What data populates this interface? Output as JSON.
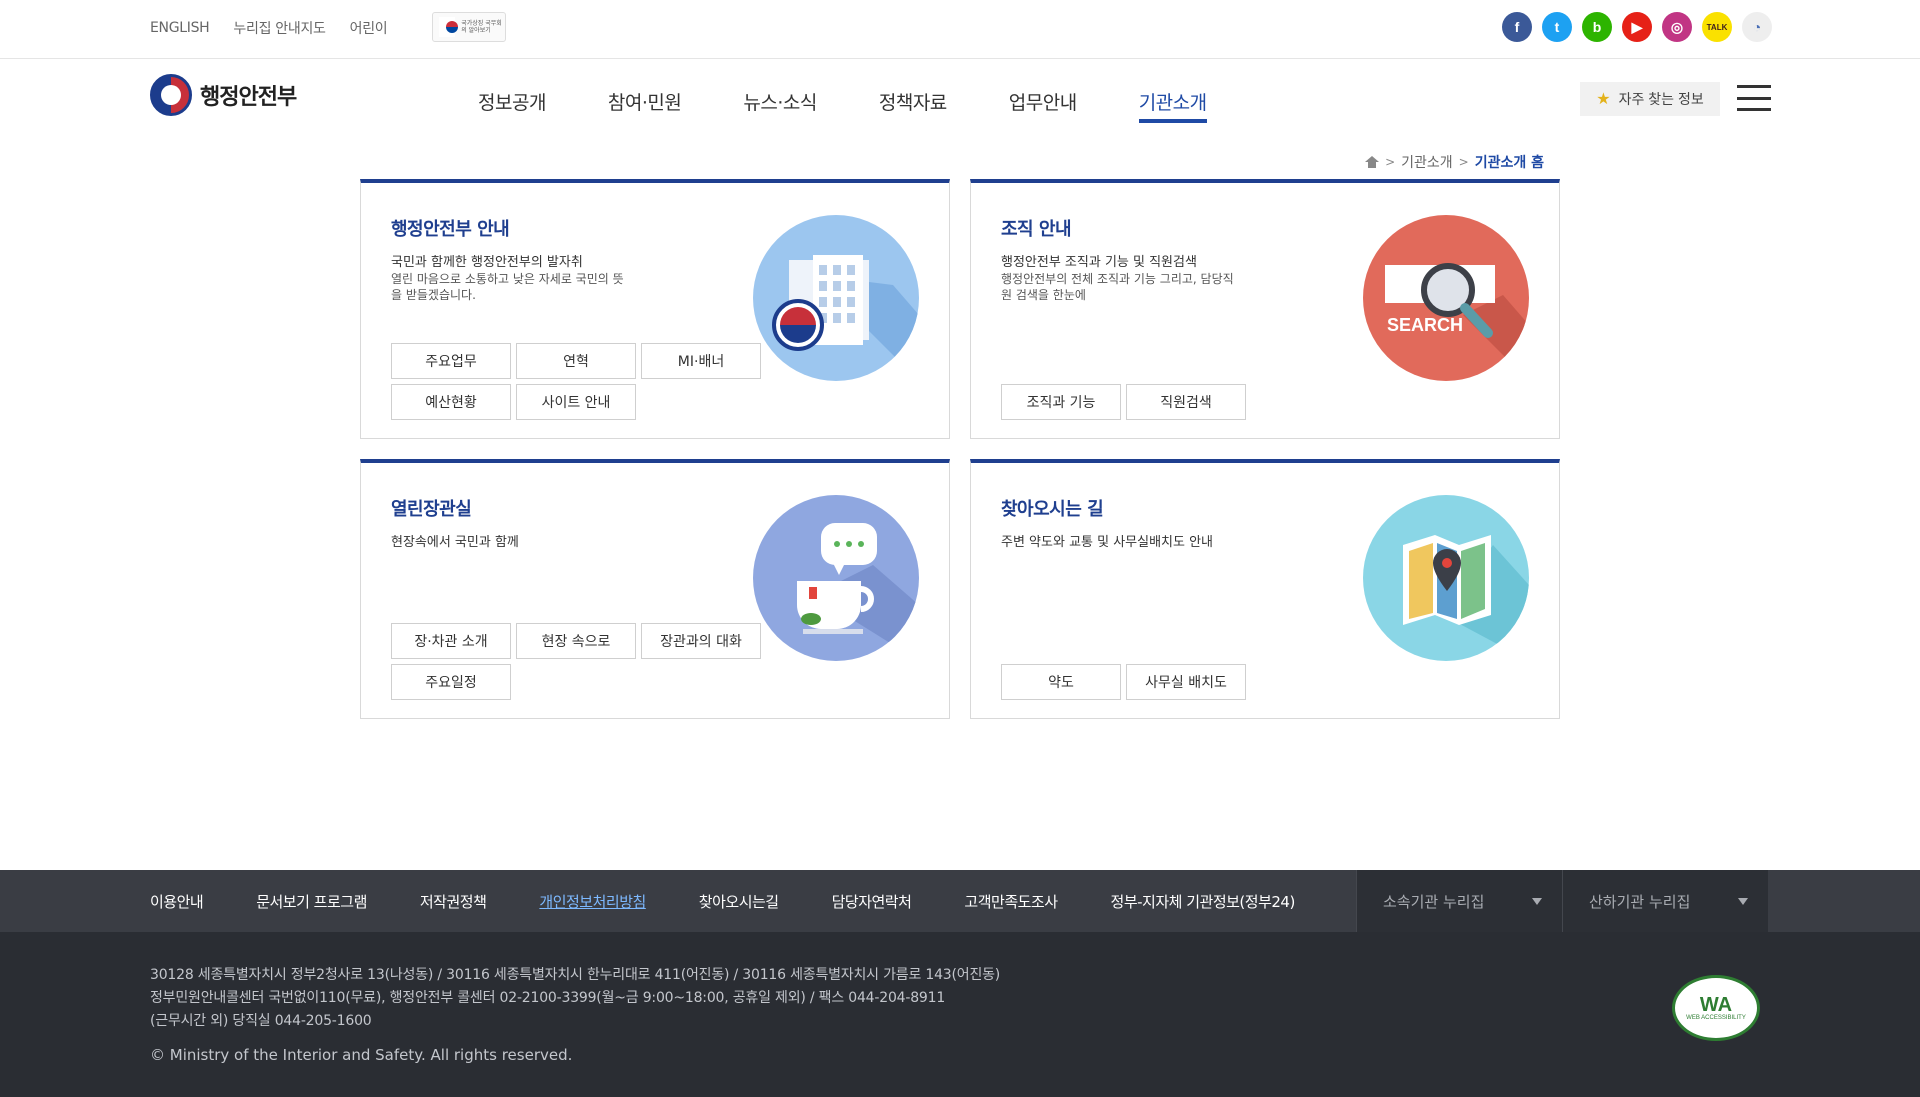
{
  "util_links": [
    "ENGLISH",
    "누리집 안내지도",
    "어린이"
  ],
  "flag_link": {
    "text": "국가상징 국무회의 알아보기"
  },
  "social": [
    {
      "name": "facebook-icon",
      "glyph": "f",
      "color": "#3b5998"
    },
    {
      "name": "twitter-icon",
      "glyph": "t",
      "color": "#1da1f2"
    },
    {
      "name": "blog-icon",
      "glyph": "b",
      "color": "#2db400"
    },
    {
      "name": "youtube-icon",
      "glyph": "▶",
      "color": "#e62117"
    },
    {
      "name": "instagram-icon",
      "glyph": "◎",
      "color": "#c13584"
    },
    {
      "name": "kakaotalk-icon",
      "glyph": "TALK",
      "color": "#fae100"
    },
    {
      "name": "app-icon",
      "glyph": "◔",
      "color": "#eeeeee"
    }
  ],
  "logo": {
    "text": "행정안전부"
  },
  "gnb": [
    "정보공개",
    "참여·민원",
    "뉴스·소식",
    "정책자료",
    "업무안내",
    "기관소개"
  ],
  "gnb_active": "기관소개",
  "favorites": {
    "label": "자주 찾는 정보"
  },
  "breadcrumb": {
    "level1": "기관소개",
    "current": "기관소개 홈"
  },
  "cards": [
    {
      "title": "행정안전부 안내",
      "lead": "국민과 함께한 행정안전부의 발자취",
      "desc": "열린 마음으로 소통하고 낮은 자세로 국민의 뜻을 받들겠습니다.",
      "buttons": [
        "주요업무",
        "연혁",
        "MI·배너",
        "예산현황",
        "사이트 안내"
      ]
    },
    {
      "title": "조직 안내",
      "lead": "행정안전부 조직과 기능 및 직원검색",
      "desc": "행정안전부의 전체 조직과 기능 그리고, 담당직원 검색을 한눈에",
      "buttons": [
        "조직과 기능",
        "직원검색"
      ],
      "illus_text": "SEARCH"
    },
    {
      "title": "열린장관실",
      "lead": "현장속에서 국민과 함께",
      "desc": "",
      "buttons": [
        "장·차관 소개",
        "현장 속으로",
        "장관과의 대화",
        "주요일정"
      ]
    },
    {
      "title": "찾아오시는 길",
      "lead": "주변 약도와 교통 및 사무실배치도 안내",
      "desc": "",
      "buttons": [
        "약도",
        "사무실 배치도"
      ]
    }
  ],
  "footer_nav": [
    "이용안내",
    "문서보기 프로그램",
    "저작권정책",
    "개인정보처리방침",
    "찾아오시는길",
    "담당자연락처",
    "고객만족도조사",
    "정부-지자체 기관정보(정부24)"
  ],
  "footer_selects": [
    "소속기관 누리집",
    "산하기관 누리집"
  ],
  "address": {
    "line1": "30128 세종특별자치시 정부2청사로 13(나성동) / 30116 세종특별자치시 한누리대로 411(어진동) / 30116 세종특별자치시 가름로 143(어진동)",
    "line2": "정부민원안내콜센터 국번없이110(무료), 행정안전부 콜센터 02-2100-3399(월~금 9:00~18:00, 공휴일 제외) / 팩스 044-204-8911",
    "line3": "(근무시간 외) 당직실 044-205-1600"
  },
  "copyright": "© Ministry of the Interior and Safety. All rights reserved.",
  "badge": {
    "text": "WA",
    "sub": "WEB ACCESSIBILITY"
  }
}
